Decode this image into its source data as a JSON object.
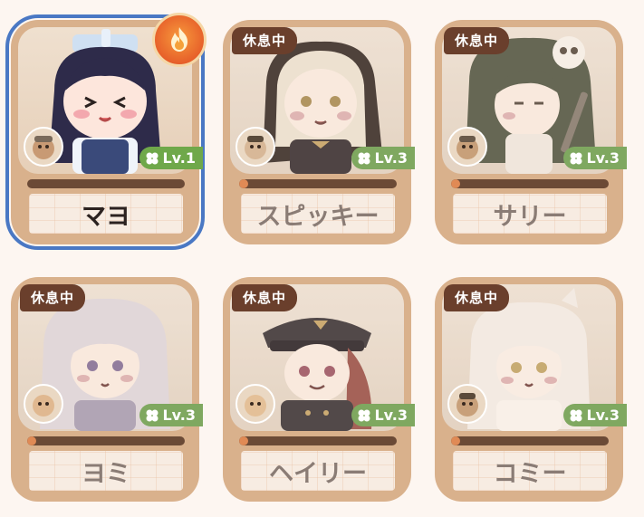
{
  "cards": [
    {
      "name": "マヨ",
      "level": "Lv.1",
      "status": "",
      "progress": 0.0,
      "selected": true
    },
    {
      "name": "スピッキー",
      "level": "Lv.3",
      "status": "休息中",
      "progress": 0.06
    },
    {
      "name": "サリー",
      "level": "Lv.3",
      "status": "休息中",
      "progress": 0.06
    },
    {
      "name": "ヨミ",
      "level": "Lv.3",
      "status": "休息中",
      "progress": 0.06
    },
    {
      "name": "ヘイリー",
      "level": "Lv.3",
      "status": "休息中",
      "progress": 0.06
    },
    {
      "name": "コミー",
      "level": "Lv.3",
      "status": "休息中",
      "progress": 0.06
    }
  ],
  "icons": {
    "selected_badge": "fire-icon",
    "level": "clover-icon"
  },
  "colors": {
    "selected_outline": "#4a78c4",
    "level_badge": "#6fa84a",
    "status_tag": "#6a3f2c",
    "progress_fill": "#e08a55",
    "card_bg": "#d9b18c"
  }
}
